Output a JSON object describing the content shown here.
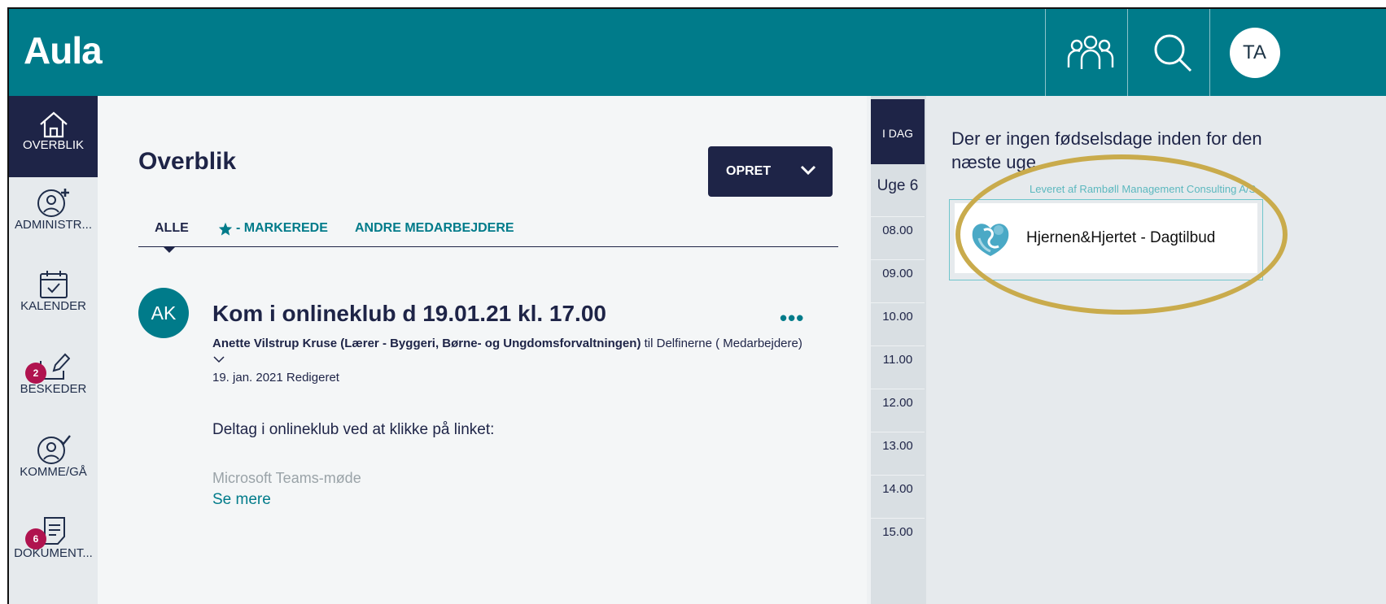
{
  "app": {
    "logo": "Aula"
  },
  "topbar": {
    "groups_icon": "people-icon",
    "search_icon": "search-icon",
    "avatar_initials": "TA"
  },
  "sidebar": {
    "items": [
      {
        "label": "OVERBLIK",
        "icon": "home-icon",
        "active": true
      },
      {
        "label": "ADMINISTR...",
        "icon": "add-user-icon"
      },
      {
        "label": "KALENDER",
        "icon": "calendar-icon"
      },
      {
        "label": "BESKEDER",
        "icon": "edit-message-icon",
        "badge": "2"
      },
      {
        "label": "KOMME/GÅ",
        "icon": "check-user-icon"
      },
      {
        "label": "DOKUMENT...",
        "icon": "document-icon",
        "badge": "6"
      }
    ]
  },
  "main": {
    "title": "Overblik",
    "create_button": "OPRET",
    "tabs": [
      {
        "label": "ALLE",
        "active": true
      },
      {
        "label": "- MARKEREDE",
        "icon": "star-icon"
      },
      {
        "label": "ANDRE MEDARBEJDERE"
      }
    ],
    "post": {
      "avatar": "AK",
      "title": "Kom i onlineklub d 19.01.21 kl. 17.00",
      "author": "Anette Vilstrup Kruse (Lærer - Byggeri, Børne- og Ungdomsforvaltningen)",
      "recipient_text": " til Delfinerne ( Medarbejdere)",
      "date": "19. jan. 2021 Redigeret",
      "body": "Deltag i onlineklub ved at klikke på linket:",
      "faded_line": "Microsoft Teams-møde",
      "see_more": "Se mere"
    }
  },
  "calendar": {
    "today": "I DAG",
    "week": "Uge 6",
    "hours": [
      "08.00",
      "09.00",
      "10.00",
      "11.00",
      "12.00",
      "13.00",
      "14.00",
      "15.00"
    ]
  },
  "right_panel": {
    "birthday_text": "Der er ingen fødselsdage inden for den næste uge",
    "provider": "Leveret af Rambøll Management Consulting A/S",
    "widget_label": "Hjernen&Hjertet - Dagtilbud"
  },
  "colors": {
    "teal": "#007b8a",
    "navy": "#1e2447",
    "badge": "#b0134f",
    "highlight": "#c9ab4c"
  }
}
